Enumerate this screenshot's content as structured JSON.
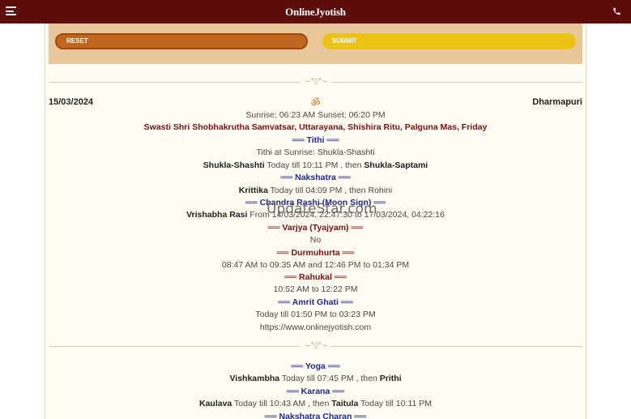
{
  "header": {
    "brand": "OnlineJyotish"
  },
  "form": {
    "reset_label": "RESET",
    "submit_label": "SUBMIT"
  },
  "ornament": "~°◊°~",
  "panchang": {
    "date": "15/03/2024",
    "place": "Dharmapuri",
    "om": "ॐ",
    "sun": "Sunrise: 06:23 AM Sunset: 06:20 PM",
    "samvat": "Swasti Shri Shobhakrutha Samvatsar, Uttarayana, Shishira Ritu, Palguna Mas, Friday",
    "tithi_head": "══ Tithi ══",
    "tithi_sunrise": "Tithi at Sunrise: Shukla-Shashti",
    "tithi_1": "Shukla-Shashti",
    "tithi_mid": " Today till 10:11 PM , then ",
    "tithi_2": "Shukla-Saptami",
    "nakshatra_head": "══ Nakshatra ══",
    "nakshatra_1": "Krittika",
    "nakshatra_mid": " Today till 04:09 PM , then Rohini",
    "rashi_head": "══ Chandra Rashi (Moon Sign) ══",
    "rashi_1": "Vrishabha Rasi",
    "rashi_mid": " From 14/03/2024, 22:47:30 to 17/03/2024, 04:22:16",
    "varjya_head": "══ Varjya (Tyajyam) ══",
    "varjya_val": "No",
    "durmuhurta_head": "══ Durmuhurta ══",
    "durmuhurta_val": "08:47 AM to 09:35 AM and 12:46 PM to 01:34 PM",
    "rahukal_head": "══ Rahukal ══",
    "rahukal_val": "10:52 AM to 12:22 PM",
    "amrit_head": "══ Amrit Ghati ══",
    "amrit_val": "Today till 01:50 PM to 03:23 PM",
    "site": "https://www.onlinejyotish.com",
    "yoga_head": "══ Yoga ══",
    "yoga_1": "Vishkambha",
    "yoga_mid": " Today till 07:45 PM , then ",
    "yoga_2": "Prithi",
    "karana_head": "══ Karana ══",
    "karana_1": "Kaulava",
    "karana_mid": " Today till 10:43 AM , then ",
    "karana_2": "Taitula",
    "karana_end": " Today till 10:11 PM",
    "charan_head": "══ Nakshatra Charan ══"
  },
  "watermark": "UpdateStar.com",
  "icons": {
    "menu": "hamburger-menu-icon",
    "phone": "phone-icon"
  },
  "colors": {
    "topbar": "#5e0b0b",
    "reset": "#c0661f",
    "submit": "#ecc314",
    "maroon": "#7a1010",
    "blue": "#1f2a90",
    "om": "#e0701c"
  }
}
